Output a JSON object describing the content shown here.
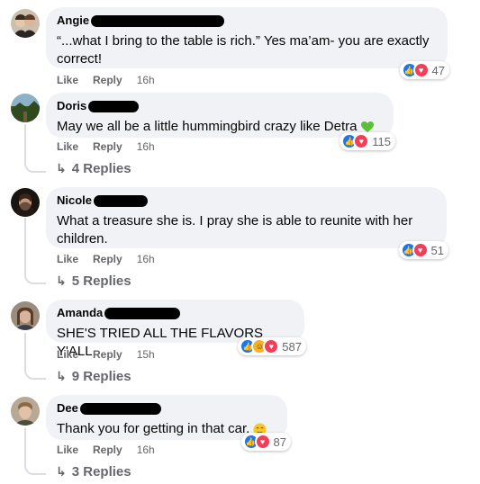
{
  "comments": [
    {
      "author": "Angie",
      "text": "“...what I bring to the table is rich.” Yes ma’am- you are exactly correct!",
      "reaction_count": "47",
      "actions": {
        "like": "Like",
        "reply": "Reply",
        "time": "16h"
      },
      "replies": ""
    },
    {
      "author": "Doris",
      "text": "May we all be a little hummingbird crazy like Detra",
      "reaction_count": "115",
      "actions": {
        "like": "Like",
        "reply": "Reply",
        "time": "16h"
      },
      "replies": "4 Replies"
    },
    {
      "author": "Nicole",
      "text": "What a treasure she is. I pray she is able to reunite with her children.",
      "reaction_count": "51",
      "actions": {
        "like": "Like",
        "reply": "Reply",
        "time": "16h"
      },
      "replies": "5 Replies"
    },
    {
      "author": "Amanda",
      "text": "SHE'S TRIED ALL THE FLAVORS Y'ALL",
      "reaction_count": "587",
      "actions": {
        "like": "Like",
        "reply": "Reply",
        "time": "15h"
      },
      "replies": "9 Replies"
    },
    {
      "author": "Dee",
      "text": "Thank you for getting in that car.",
      "reaction_count": "87",
      "actions": {
        "like": "Like",
        "reply": "Reply",
        "time": "16h"
      },
      "replies": "3 Replies"
    }
  ],
  "colors": {
    "bubble": "#f0f2f5",
    "secondary_text": "#65676b",
    "like_blue": "#1877f2",
    "love_red": "#f33e58",
    "emoji_heart": "#59c135"
  },
  "icons": [
    "like-reaction-icon",
    "love-reaction-icon",
    "haha-reaction-icon",
    "reply-arrow-icon",
    "green-heart-emoji",
    "relieved-face-emoji"
  ]
}
